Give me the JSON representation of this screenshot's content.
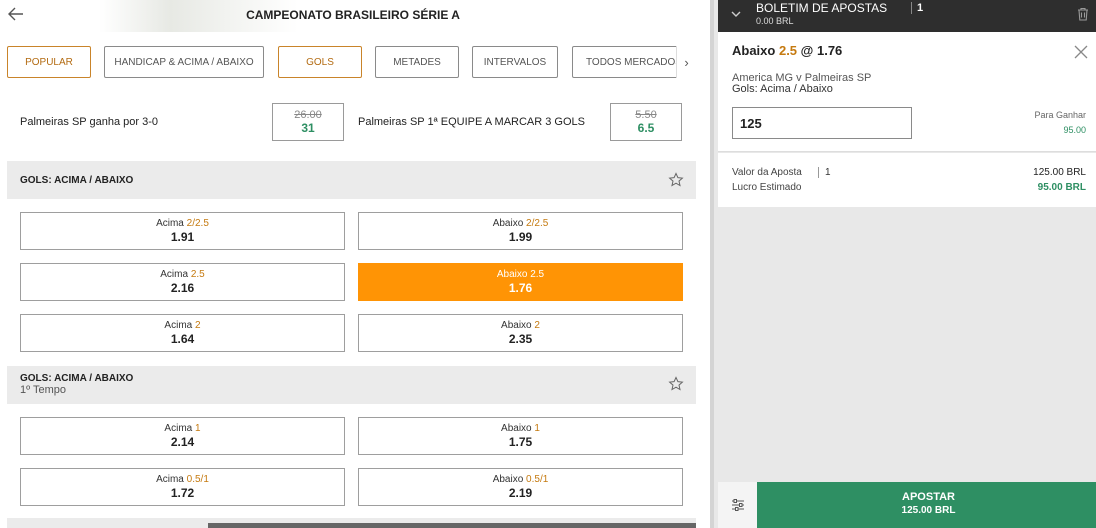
{
  "header": {
    "title": "CAMPEONATO BRASILEIRO SÉRIE A",
    "back_icon": "arrow-left-icon"
  },
  "tabs": [
    {
      "label": "POPULAR",
      "active": true
    },
    {
      "label": "HANDICAP & ACIMA / ABAIXO",
      "active": false
    },
    {
      "label": "GOLS",
      "active": true
    },
    {
      "label": "METADES",
      "active": false
    },
    {
      "label": "INTERVALOS",
      "active": false
    },
    {
      "label": "TODOS MERCADOS",
      "active": false
    }
  ],
  "specials": [
    {
      "label": "Palmeiras SP ganha por 3-0",
      "old_odds": "26.00",
      "odds": "31"
    },
    {
      "label": "Palmeiras SP 1ª EQUIPE A MARCAR 3 GOLS",
      "old_odds": "5.50",
      "odds": "6.5"
    }
  ],
  "sections": [
    {
      "title": "GOLS: ACIMA / ABAIXO",
      "subtitle": "",
      "rows": [
        [
          {
            "side": "Acima",
            "line": "2/2.5",
            "odds": "1.91"
          },
          {
            "side": "Abaixo",
            "line": "2/2.5",
            "odds": "1.99"
          }
        ],
        [
          {
            "side": "Acima",
            "line": "2.5",
            "odds": "2.16"
          },
          {
            "side": "Abaixo",
            "line": "2.5",
            "odds": "1.76",
            "selected": true
          }
        ],
        [
          {
            "side": "Acima",
            "line": "2",
            "odds": "1.64"
          },
          {
            "side": "Abaixo",
            "line": "2",
            "odds": "2.35"
          }
        ]
      ]
    },
    {
      "title": "GOLS: ACIMA / ABAIXO",
      "subtitle": "1º Tempo",
      "rows": [
        [
          {
            "side": "Acima",
            "line": "1",
            "odds": "2.14"
          },
          {
            "side": "Abaixo",
            "line": "1",
            "odds": "1.75"
          }
        ],
        [
          {
            "side": "Acima",
            "line": "0.5/1",
            "odds": "1.72"
          },
          {
            "side": "Abaixo",
            "line": "0.5/1",
            "odds": "2.19"
          }
        ]
      ]
    }
  ],
  "betslip": {
    "title": "BOLETIM DE APOSTAS",
    "count": "1",
    "balance": "0.00 BRL",
    "pick_side": "Abaixo",
    "pick_line": "2.5",
    "pick_at": "@",
    "pick_odds": "1.76",
    "match": "America MG v Palmeiras SP",
    "market": "Gols: Acima / Abaixo",
    "stake_value": "125",
    "to_win_label": "Para Ganhar",
    "to_win_value": "95.00",
    "stake_label": "Valor da Aposta",
    "stake_count": "1",
    "stake_total": "125.00 BRL",
    "profit_label": "Lucro Estimado",
    "profit_value": "95.00 BRL",
    "place_label": "APOSTAR",
    "place_amount": "125.00 BRL"
  },
  "colors": {
    "accent": "#ff9405",
    "line": "#c57a10",
    "success": "#2e8f63",
    "slip_header": "#2e2e2e"
  }
}
